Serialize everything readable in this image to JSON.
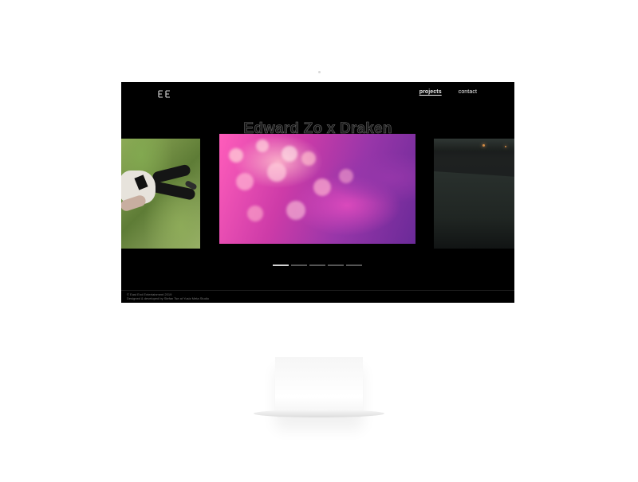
{
  "site": {
    "logo_text": "EE",
    "nav": [
      {
        "label": "projects",
        "active": true
      },
      {
        "label": "contact",
        "active": false
      }
    ],
    "hero_title": "Edward Zo x Draken",
    "slider": {
      "pages": 5,
      "active_index": 0
    },
    "footer": {
      "line1": "© East End Entertainment 2019",
      "line2": "Designed & developed by Stefan Tse at Yusiz Meta Studio"
    }
  },
  "icons": {
    "logo": "logo-icon"
  },
  "colors": {
    "screen_bg": "#000000",
    "nav_text": "#f2f2f2",
    "pager_active": "#d2d2d2",
    "pager_inactive": "#555555",
    "accent_pink": "#ff5dbb",
    "accent_purple": "#9836a9"
  }
}
